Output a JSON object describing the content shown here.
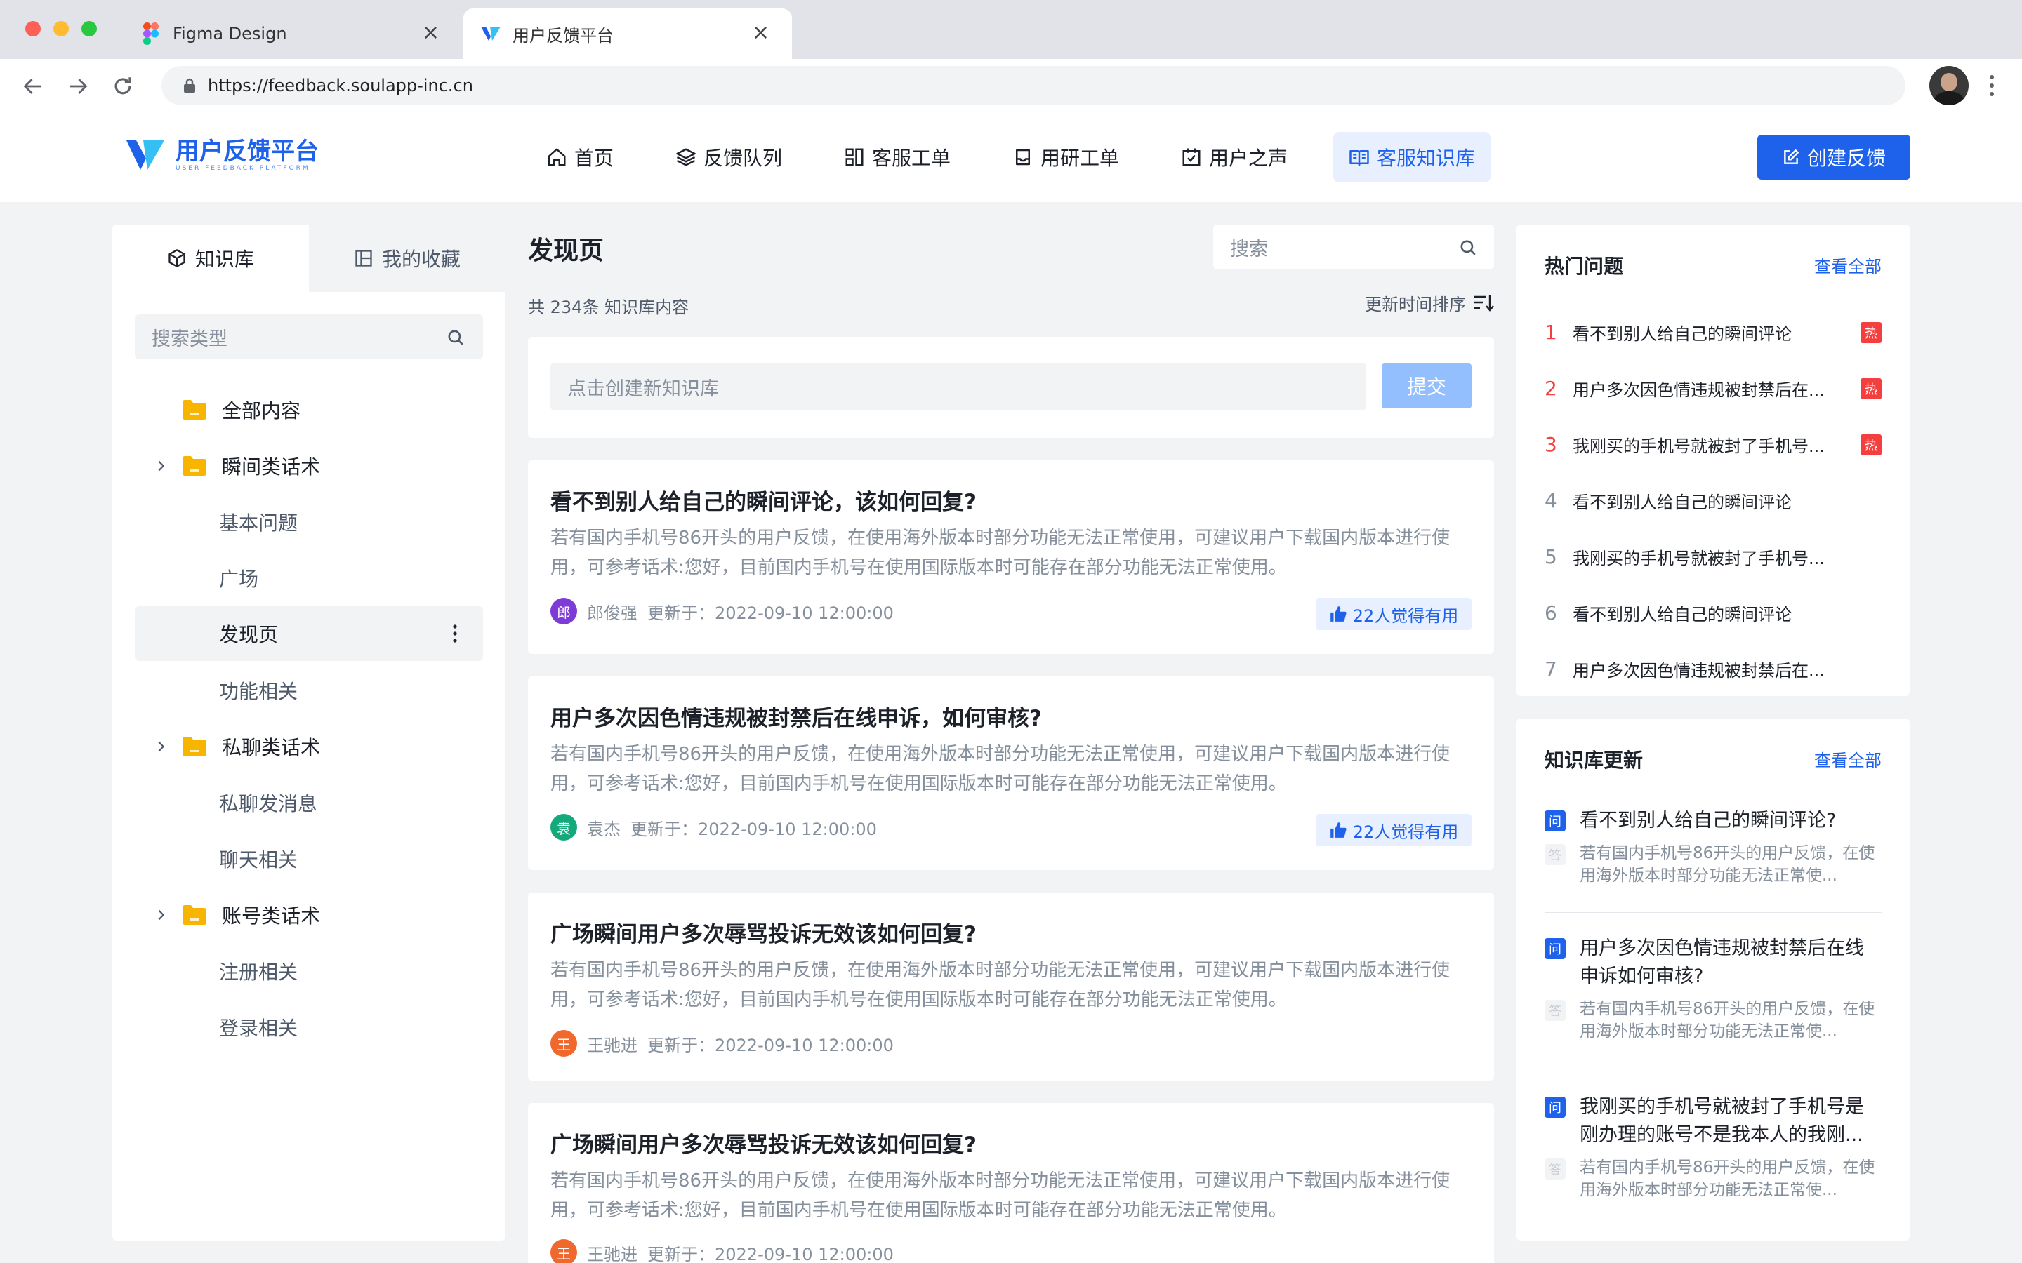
{
  "browser": {
    "tabs": [
      {
        "label": "Figma Design"
      },
      {
        "label": "用户反馈平台"
      }
    ],
    "url": "https://feedback.soulapp-inc.cn"
  },
  "header": {
    "logo_title": "用户反馈平台",
    "logo_subtitle": "USER FEEDBACK PLATFORM",
    "nav": [
      {
        "label": "首页",
        "icon": "home-icon"
      },
      {
        "label": "反馈队列",
        "icon": "layers-icon"
      },
      {
        "label": "客服工单",
        "icon": "grid-icon"
      },
      {
        "label": "用研工单",
        "icon": "inbox-icon"
      },
      {
        "label": "用户之声",
        "icon": "calendar-check-icon"
      },
      {
        "label": "客服知识库",
        "icon": "book-icon",
        "active": true
      }
    ],
    "create_label": "创建反馈"
  },
  "sidebar": {
    "tabs": [
      {
        "label": "知识库",
        "active": true
      },
      {
        "label": "我的收藏"
      }
    ],
    "search_placeholder": "搜索类型",
    "tree": [
      {
        "label": "全部内容",
        "type": "folder"
      },
      {
        "label": "瞬间类话术",
        "type": "folder",
        "expandable": true
      },
      {
        "label": "基本问题",
        "type": "item"
      },
      {
        "label": "广场",
        "type": "item"
      },
      {
        "label": "发现页",
        "type": "item",
        "selected": true
      },
      {
        "label": "功能相关",
        "type": "item"
      },
      {
        "label": "私聊类话术",
        "type": "folder",
        "expandable": true
      },
      {
        "label": "私聊发消息",
        "type": "item"
      },
      {
        "label": "聊天相关",
        "type": "item"
      },
      {
        "label": "账号类话术",
        "type": "folder",
        "expandable": true
      },
      {
        "label": "注册相关",
        "type": "item"
      },
      {
        "label": "登录相关",
        "type": "item"
      }
    ]
  },
  "main": {
    "title": "发现页",
    "search_placeholder": "搜索",
    "count_text": "共 234条 知识库内容",
    "sort_label": "更新时间排序",
    "create_placeholder": "点击创建新知识库",
    "submit_label": "提交",
    "articles": [
      {
        "title": "看不到别人给自己的瞬间评论，该如何回复?",
        "body": "若有国内手机号86开头的用户反馈，在使用海外版本时部分功能无法正常使用，可建议用户下载国内版本进行使用，可参考话术:您好，目前国内手机号在使用国际版本时可能存在部分功能无法正常使用。",
        "avatar": "郎",
        "avatar_color": "#7e3bd6",
        "author": "郎俊强",
        "updated": "更新于：2022-09-10 12:00:00",
        "useful": "22人觉得有用"
      },
      {
        "title": "用户多次因色情违规被封禁后在线申诉，如何审核?",
        "body": "若有国内手机号86开头的用户反馈，在使用海外版本时部分功能无法正常使用，可建议用户下载国内版本进行使用，可参考话术:您好，目前国内手机号在使用国际版本时可能存在部分功能无法正常使用。",
        "avatar": "袁",
        "avatar_color": "#14a97a",
        "author": "袁杰",
        "updated": "更新于：2022-09-10 12:00:00",
        "useful": "22人觉得有用"
      },
      {
        "title": "广场瞬间用户多次辱骂投诉无效该如何回复?",
        "body": "若有国内手机号86开头的用户反馈，在使用海外版本时部分功能无法正常使用，可建议用户下载国内版本进行使用，可参考话术:您好，目前国内手机号在使用国际版本时可能存在部分功能无法正常使用。",
        "avatar": "王",
        "avatar_color": "#f0682c",
        "author": "王驰进",
        "updated": "更新于：2022-09-10 12:00:00",
        "useful": ""
      },
      {
        "title": "广场瞬间用户多次辱骂投诉无效该如何回复?",
        "body": "若有国内手机号86开头的用户反馈，在使用海外版本时部分功能无法正常使用，可建议用户下载国内版本进行使用，可参考话术:您好，目前国内手机号在使用国际版本时可能存在部分功能无法正常使用。",
        "avatar": "王",
        "avatar_color": "#f0682c",
        "author": "王驰进",
        "updated": "更新于：2022-09-10 12:00:00",
        "useful": ""
      }
    ]
  },
  "hot": {
    "title": "热门问题",
    "more": "查看全部",
    "badge": "热",
    "items": [
      {
        "rank": "1",
        "text": "看不到别人给自己的瞬间评论",
        "hot": true
      },
      {
        "rank": "2",
        "text": "用户多次因色情违规被封禁后在...",
        "hot": true
      },
      {
        "rank": "3",
        "text": "我刚买的手机号就被封了手机号...",
        "hot": true
      },
      {
        "rank": "4",
        "text": "看不到别人给自己的瞬间评论",
        "hot": false
      },
      {
        "rank": "5",
        "text": "我刚买的手机号就被封了手机号...",
        "hot": false
      },
      {
        "rank": "6",
        "text": "看不到别人给自己的瞬间评论",
        "hot": false
      },
      {
        "rank": "7",
        "text": "用户多次因色情违规被封禁后在...",
        "hot": false
      }
    ]
  },
  "updates": {
    "title": "知识库更新",
    "more": "查看全部",
    "q_icon": "问",
    "a_icon": "答",
    "items": [
      {
        "q": "看不到别人给自己的瞬间评论?",
        "a": "若有国内手机号86开头的用户反馈，在使用海外版本时部分功能无法正常使..."
      },
      {
        "q": "用户多次因色情违规被封禁后在线申诉如何审核?",
        "a": "若有国内手机号86开头的用户反馈，在使用海外版本时部分功能无法正常使..."
      },
      {
        "q": "我刚买的手机号就被封了手机号是刚办理的账号不是我本人的我刚...",
        "a": "若有国内手机号86开头的用户反馈，在使用海外版本时部分功能无法正常使..."
      }
    ]
  },
  "colors": {
    "primary": "#1e62ec",
    "hot": "#f53f3f",
    "folder": "#f7b500",
    "bg": "#f2f3f5"
  }
}
